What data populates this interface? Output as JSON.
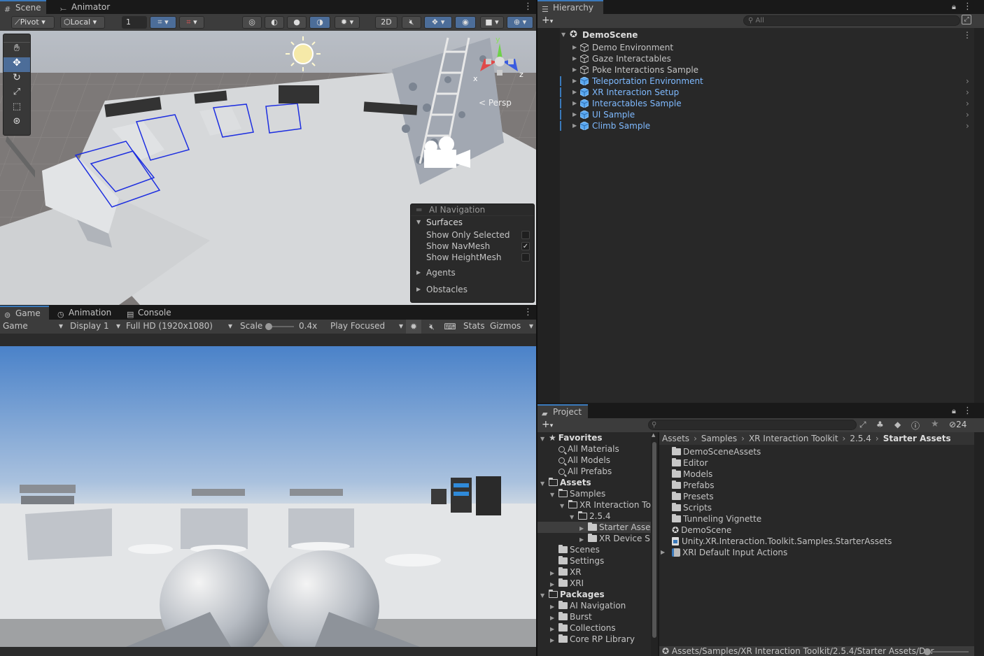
{
  "scene_panel": {
    "tabs": [
      {
        "label": "Scene"
      },
      {
        "label": "Animator"
      }
    ],
    "toolbar": {
      "pivot": "Pivot",
      "local": "Local",
      "snap_value": "1",
      "mode_2d": "2D"
    },
    "gizmo": {
      "persp_label": "< Persp",
      "axis_y": "y",
      "axis_x": "x",
      "axis_z": "z"
    }
  },
  "ai_navigation": {
    "title": "AI Navigation",
    "surfaces": "Surfaces",
    "options": [
      {
        "label": "Show Only Selected",
        "checked": false
      },
      {
        "label": "Show NavMesh",
        "checked": true
      },
      {
        "label": "Show HeightMesh",
        "checked": false
      }
    ],
    "agents": "Agents",
    "obstacles": "Obstacles"
  },
  "game_panel": {
    "tabs": [
      {
        "label": "Game"
      },
      {
        "label": "Animation"
      },
      {
        "label": "Console"
      }
    ],
    "toolbar": {
      "game": "Game",
      "display": "Display 1",
      "resolution": "Full HD (1920x1080)",
      "scale_label": "Scale",
      "scale_value": "0.4x",
      "play_mode": "Play Focused",
      "stats": "Stats",
      "gizmos": "Gizmos"
    }
  },
  "hierarchy": {
    "tab": "Hierarchy",
    "search_placeholder": "All",
    "root": "DemoScene",
    "items": [
      {
        "label": "Demo Environment",
        "prefab": false
      },
      {
        "label": "Gaze Interactables",
        "prefab": false
      },
      {
        "label": "Poke Interactions Sample",
        "prefab": false
      },
      {
        "label": "Teleportation Environment",
        "prefab": true
      },
      {
        "label": "XR Interaction Setup",
        "prefab": true
      },
      {
        "label": "Interactables Sample",
        "prefab": true
      },
      {
        "label": "UI Sample",
        "prefab": true
      },
      {
        "label": "Climb Sample",
        "prefab": true
      }
    ]
  },
  "project": {
    "tab": "Project",
    "hidden_count": "24",
    "tree": [
      {
        "label": "Favorites",
        "type": "header",
        "indent": 0
      },
      {
        "label": "All Materials",
        "type": "search",
        "indent": 1
      },
      {
        "label": "All Models",
        "type": "search",
        "indent": 1
      },
      {
        "label": "All Prefabs",
        "type": "search",
        "indent": 1
      },
      {
        "label": "Assets",
        "type": "header-folder",
        "indent": 0
      },
      {
        "label": "Samples",
        "type": "open",
        "indent": 1
      },
      {
        "label": "XR Interaction To",
        "type": "open",
        "indent": 2
      },
      {
        "label": "2.5.4",
        "type": "open",
        "indent": 3
      },
      {
        "label": "Starter Asse",
        "type": "selected",
        "indent": 4
      },
      {
        "label": "XR Device S",
        "type": "closed",
        "indent": 4
      },
      {
        "label": "Scenes",
        "type": "leaf",
        "indent": 1
      },
      {
        "label": "Settings",
        "type": "leaf",
        "indent": 1
      },
      {
        "label": "XR",
        "type": "closed",
        "indent": 1
      },
      {
        "label": "XRI",
        "type": "closed",
        "indent": 1
      },
      {
        "label": "Packages",
        "type": "header-folder",
        "indent": 0
      },
      {
        "label": "AI Navigation",
        "type": "closed",
        "indent": 1
      },
      {
        "label": "Burst",
        "type": "closed",
        "indent": 1
      },
      {
        "label": "Collections",
        "type": "closed",
        "indent": 1
      },
      {
        "label": "Core RP Library",
        "type": "closed",
        "indent": 1
      }
    ],
    "breadcrumb": [
      "Assets",
      "Samples",
      "XR Interaction Toolkit",
      "2.5.4",
      "Starter Assets"
    ],
    "contents": [
      {
        "label": "DemoSceneAssets",
        "kind": "folder"
      },
      {
        "label": "Editor",
        "kind": "folder"
      },
      {
        "label": "Models",
        "kind": "folder"
      },
      {
        "label": "Prefabs",
        "kind": "folder"
      },
      {
        "label": "Presets",
        "kind": "folder"
      },
      {
        "label": "Scripts",
        "kind": "folder"
      },
      {
        "label": "Tunneling Vignette",
        "kind": "folder"
      },
      {
        "label": "DemoScene",
        "kind": "scene"
      },
      {
        "label": "Unity.XR.Interaction.Toolkit.Samples.StarterAssets",
        "kind": "asmdef"
      },
      {
        "label": "XRI Default Input Actions",
        "kind": "input"
      }
    ],
    "status_path": "Assets/Samples/XR Interaction Toolkit/2.5.4/Starter Assets/Der"
  }
}
